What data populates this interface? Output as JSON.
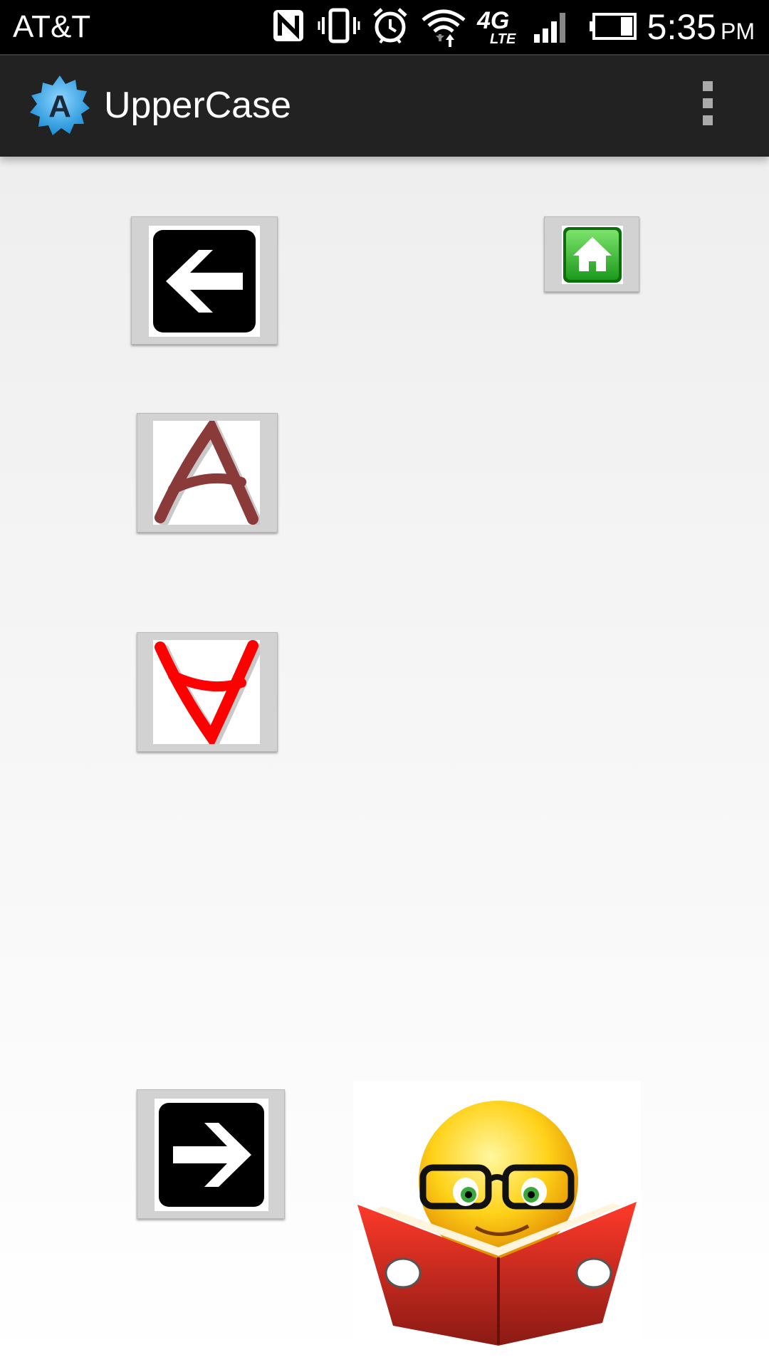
{
  "status_bar": {
    "carrier": "AT&T",
    "time": "5:35",
    "ampm": "PM",
    "icons": [
      "nfc-icon",
      "vibrate-icon",
      "alarm-icon",
      "wifi-icon",
      "4g-lte-icon",
      "signal-icon",
      "battery-icon"
    ],
    "network_label": "4G",
    "network_sublabel": "LTE"
  },
  "action_bar": {
    "title": "UpperCase",
    "app_icon_letter": "A",
    "overflow_icon": "overflow-menu-icon"
  },
  "tiles": {
    "back": {
      "icon": "arrow-left-icon"
    },
    "home": {
      "icon": "home-icon"
    },
    "letter_a": {
      "letter": "A",
      "color": "#8b3a3a"
    },
    "letter_a_flipped": {
      "letter": "A",
      "color": "#ff0000"
    },
    "next": {
      "icon": "arrow-right-icon"
    }
  },
  "colors": {
    "status_bar": "#000000",
    "action_bar": "#222222",
    "home_green": "#2fb52f",
    "book_red": "#d22a20",
    "smiley_yellow": "#ffd21a"
  }
}
